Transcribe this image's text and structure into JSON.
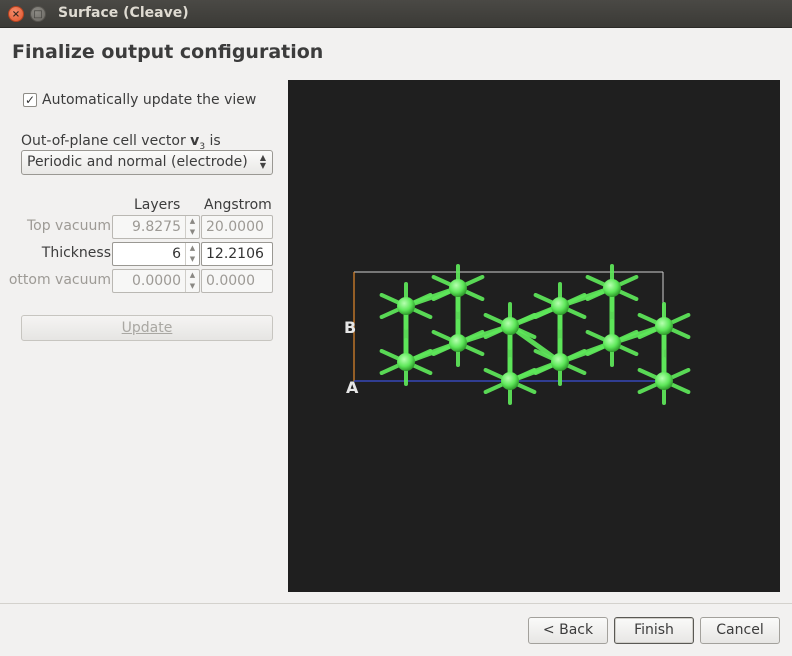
{
  "window": {
    "title": "Surface (Cleave)"
  },
  "page": {
    "heading": "Finalize output configuration"
  },
  "auto_update": {
    "checked": true,
    "label": "Automatically update the view"
  },
  "vector": {
    "label_prefix": "Out-of-plane cell vector ",
    "label_bold": "v",
    "label_sub": "3",
    "label_suffix": " is",
    "selected": "Periodic and normal (electrode)"
  },
  "table": {
    "col_layers": "Layers",
    "col_angstrom": "Angstrom",
    "rows": [
      {
        "label": "Top vacuum",
        "layers": "9.8275",
        "angstrom": "20.0000",
        "enabled": false
      },
      {
        "label": "Thickness",
        "layers": "6",
        "angstrom": "12.2106",
        "enabled": true
      },
      {
        "label": "ottom vacuum",
        "layers": "0.0000",
        "angstrom": "0.0000",
        "enabled": false
      }
    ]
  },
  "update_button": "Update",
  "viewer": {
    "label_b": "B",
    "label_a": "A",
    "colors": {
      "background": "#1f1f1f",
      "atom": "#5ee85a",
      "cell": "#cfcfcf",
      "axis_a": "#3b4fd8",
      "axis_b": "#e38a2d"
    }
  },
  "footer": {
    "back": "< Back",
    "finish": "Finish",
    "cancel": "Cancel"
  }
}
